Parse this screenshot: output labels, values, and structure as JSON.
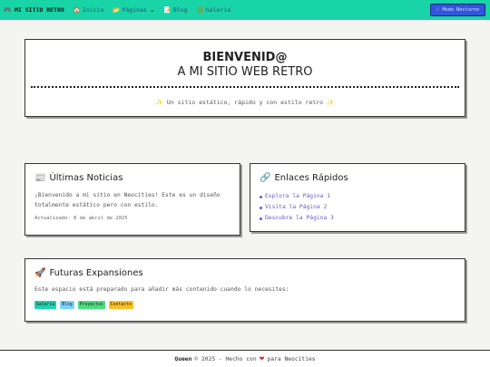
{
  "nav": {
    "brand": "MI SITIO RETRO",
    "brand_icon": "gamepad-icon",
    "items": [
      {
        "label": "Inicio",
        "icon": "home-icon"
      },
      {
        "label": "Páginas",
        "icon": "folder-icon",
        "has_dropdown": true
      },
      {
        "label": "Blog",
        "icon": "notes-icon"
      },
      {
        "label": "Galería",
        "icon": "picture-icon"
      }
    ],
    "mode_button": "Modo Nocturno"
  },
  "hero": {
    "title_line1": "BIENVENID@",
    "title_line2": "A MI SITIO WEB RETRO",
    "subtitle": "Un sitio estático, rápido y con estilo retro"
  },
  "news": {
    "title": "Últimas Noticias",
    "body": "¡Bienvenido a mi sitio en Neocities! Este es un diseño totalmente estático pero con estilo.",
    "updated": "Actualizado: 8 de abril de 2025"
  },
  "links": {
    "title": "Enlaces Rápidos",
    "items": [
      "Explora la Página 1",
      "Visita la Página 2",
      "Descubre la Página 3"
    ]
  },
  "future": {
    "title": "Futuras Expansiones",
    "body": "Este espacio está preparado para añadir más contenido cuando lo necesites:",
    "tags": [
      {
        "label": "Galería",
        "color": "#22d3b0"
      },
      {
        "label": "Blog",
        "color": "#7dd3fc"
      },
      {
        "label": "Proyectos",
        "color": "#4ade80"
      },
      {
        "label": "Contacto",
        "color": "#fbbf24"
      }
    ]
  },
  "footer": {
    "owner": "Queen",
    "text_before": "© 2025 - Hecho con",
    "text_after": "para Neocities"
  }
}
